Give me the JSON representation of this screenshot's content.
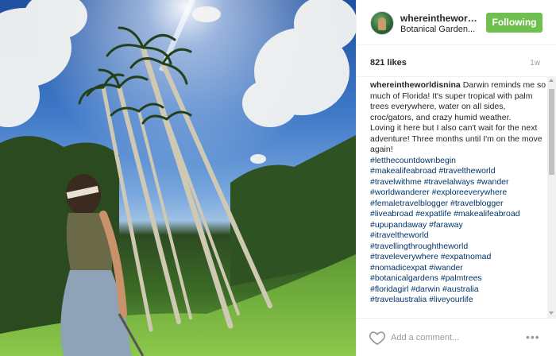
{
  "post": {
    "username": "whereintheworldisnina",
    "username_truncated": "whereintheworld...",
    "location": "Botanical Garden...",
    "follow_label": "Following",
    "likes": "821 likes",
    "time_ago": "1w",
    "caption_user": "whereintheworldisnina",
    "caption_line1": " Darwin reminds me so much of Florida! It's super tropical with palm trees everywhere, water on all sides, croc/gators, and crazy humid weather.",
    "caption_line2": "Loving it here but I also can't wait for the next adventure! Three months until I'm on the move again!",
    "hashtags": [
      "#letthecountdownbegin",
      "#makealifeabroad #traveltheworld",
      "#travelwithme #travelalways #wander",
      "#worldwanderer #exploreeverywhere",
      "#femaletravelblogger #travelblogger",
      "#liveabroad #expatlife #makealifeabroad",
      "#upupandaway #faraway",
      "#itraveltheworld",
      "#travellingthroughtheworld",
      "#traveleverywhere #expatnomad",
      "#nomadicexpat #iwander",
      "#botanicalgardens #palmtrees",
      "#floridagirl #darwin #australia",
      "#travelaustralia #liveyourlife"
    ]
  },
  "comment": {
    "placeholder": "Add a comment..."
  },
  "more_label": "•••",
  "colors": {
    "follow_button": "#70c050",
    "hashtag": "#003569"
  },
  "icons": {
    "like": "heart-icon",
    "more": "more-options-icon",
    "avatar": "profile-avatar"
  }
}
